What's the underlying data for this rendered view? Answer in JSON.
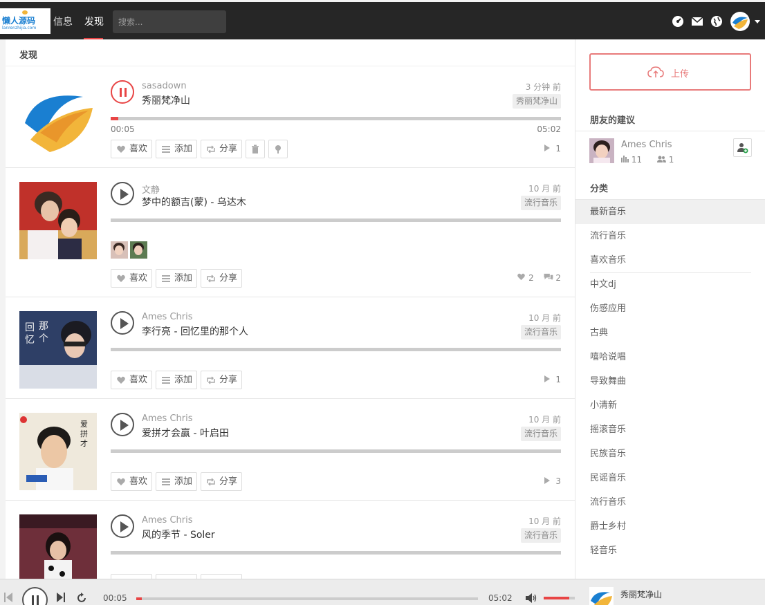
{
  "nav": {
    "logo_text": "懒人源码",
    "logo_sub": "lanrenzhijia.com",
    "links": [
      "信息",
      "发现"
    ],
    "search_placeholder": "搜索..."
  },
  "main": {
    "title": "发现",
    "tracks": [
      {
        "user": "sasadown",
        "title": "秀丽梵净山",
        "time_ago": "3 分钟 前",
        "tag": "秀丽梵净山",
        "state": "playing",
        "current_time": "00:05",
        "duration": "05:02",
        "progress": 0.017,
        "like_label": "喜欢",
        "add_label": "添加",
        "share_label": "分享",
        "plays": "1"
      },
      {
        "user": "文静",
        "title": "梦中的额吉(蒙) - 乌达木",
        "time_ago": "10 月 前",
        "tag": "流行音乐",
        "state": "paused",
        "like_label": "喜欢",
        "add_label": "添加",
        "share_label": "分享",
        "likes": "2",
        "comments": "2"
      },
      {
        "user": "Ames Chris",
        "title": "李行亮 - 回忆里的那个人",
        "time_ago": "10 月 前",
        "tag": "流行音乐",
        "state": "paused",
        "like_label": "喜欢",
        "add_label": "添加",
        "share_label": "分享",
        "plays": "1"
      },
      {
        "user": "Ames Chris",
        "title": "爱拼才会赢 - 叶启田",
        "time_ago": "10 月 前",
        "tag": "流行音乐",
        "state": "paused",
        "like_label": "喜欢",
        "add_label": "添加",
        "share_label": "分享",
        "plays": "3"
      },
      {
        "user": "Ames Chris",
        "title": "风的季节 - Soler",
        "time_ago": "10 月 前",
        "tag": "流行音乐",
        "state": "paused"
      }
    ]
  },
  "sidebar": {
    "upload_label": "上传",
    "friends_heading": "朋友的建议",
    "friend": {
      "name": "Ames Chris",
      "tracks": "11",
      "followers": "1"
    },
    "category_heading": "分类",
    "categories": [
      "最新音乐",
      "流行音乐",
      "喜欢音乐",
      "中文dj",
      "伤感应用",
      "古典",
      "嘻哈说唱",
      "导致舞曲",
      "小清新",
      "摇滚音乐",
      "民族音乐",
      "民谣音乐",
      "流行音乐",
      "爵士乡村",
      "轻音乐"
    ],
    "active_category": "最新音乐"
  },
  "player": {
    "current_time": "00:05",
    "duration": "05:02",
    "progress": 0.017,
    "volume": 0.82,
    "title": "秀丽梵净山"
  },
  "colors": {
    "accent": "#e84545",
    "topbar": "#262626"
  }
}
